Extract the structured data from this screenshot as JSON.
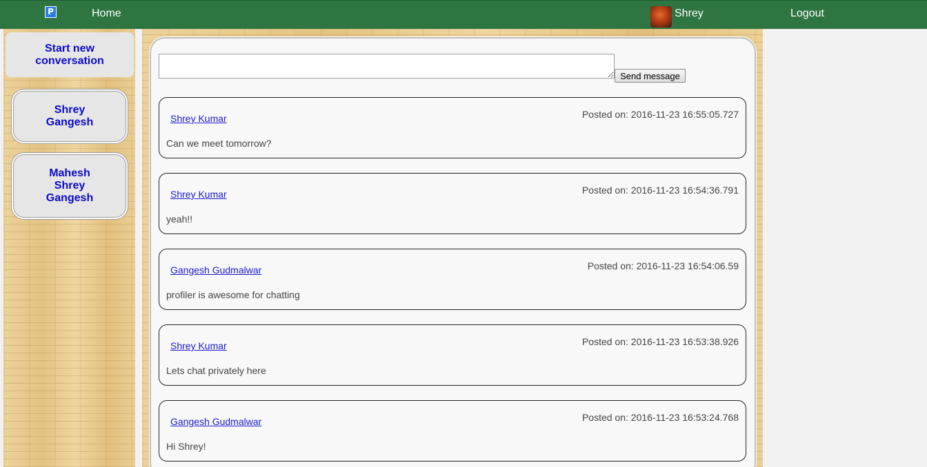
{
  "topbar": {
    "logo_letter": "P",
    "home_label": "Home",
    "user_name": "Shrey",
    "logout_label": "Logout"
  },
  "sidebar": {
    "start_label": "Start new conversation",
    "conversations": [
      {
        "lines": [
          "Shrey",
          "Gangesh"
        ]
      },
      {
        "lines": [
          "Mahesh",
          "Shrey",
          "Gangesh"
        ]
      }
    ]
  },
  "composer": {
    "input_value": "",
    "send_label": "Send message"
  },
  "messages": [
    {
      "author": "Shrey Kumar",
      "time": "Posted on: 2016-11-23 16:55:05.727",
      "text": "Can we meet tomorrow?"
    },
    {
      "author": "Shrey Kumar",
      "time": "Posted on: 2016-11-23 16:54:36.791",
      "text": "yeah!!"
    },
    {
      "author": "Gangesh Gudmalwar",
      "time": "Posted on: 2016-11-23 16:54:06.59",
      "text": "profiler is awesome for chatting"
    },
    {
      "author": "Shrey Kumar",
      "time": "Posted on: 2016-11-23 16:53:38.926",
      "text": "Lets chat privately here"
    },
    {
      "author": "Gangesh Gudmalwar",
      "time": "Posted on: 2016-11-23 16:53:24.768",
      "text": "Hi Shrey!"
    }
  ],
  "colors": {
    "topbar": "#2e7541",
    "link": "#1a1acc",
    "conversation_text": "#0a0acc"
  }
}
